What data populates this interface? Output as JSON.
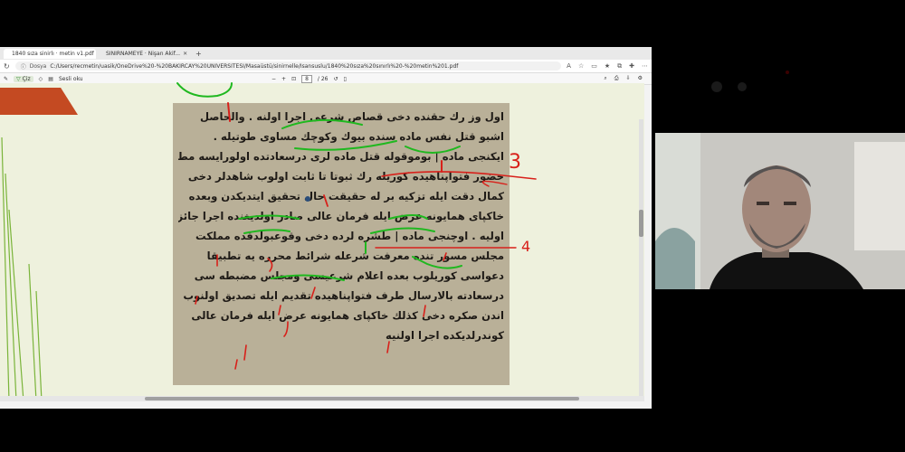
{
  "browser": {
    "tabs": [
      {
        "label": "1840 sıza sinirlı · metin v1.pdf",
        "active": true,
        "icon": "pdf-icon"
      },
      {
        "label": "SINIRNAMEYE · Nişan Akif...",
        "active": false,
        "icon": "page-icon"
      }
    ],
    "new_tab_label": "+",
    "address": {
      "site_label": "Dosya",
      "url": "C:/Users/recmetin/uasik/OneDrive%20-%20BAKIRCAY%20UNIVERSITESI/Masaüstü/sinirnelle/Isansuslu/1840%20sıza%20sınırlı%20-%20metin%201.pdf"
    },
    "pdf_toolbar": {
      "draw_label": "Çiz",
      "page_current": "8",
      "page_total": "/ 26",
      "zoom_minus": "−",
      "zoom_plus": "+",
      "read_aloud": "Sesli oku"
    }
  },
  "manuscript": {
    "lines": [
      "اول وز رك حقنده دخی قصاص شرعی اجرا اولنه . والحاصل",
      "اشبو قتل نفس ماده سنده بیوك وكوچك مساوی طوتیله .",
      "ایكنجی ماده | بوموقوله قتل ماده لری درسعادتده اولورایسه مطلقا",
      "حضور فتواپناهیده كوریله رك ثبوتا تا ثابت اولوب شاهدلر دخی",
      "كمال دقت ایله تزكیه بر له حقیقت حال تحقیق ایتدیكدن وبعده",
      "خاكپای همایونه عرض ایله فرمان عالی صادر اولدیغنده اجرا جائز",
      "اولیه . اوچنجی ماده | طشره لرده دخی وقوعبولدقده مملكت",
      "مجلس مسور تنده معرفت شرعله شرائط محرره یه تطبیقا",
      "دعواسی كوریلوب بعده اعلام شرعیسی ومجلس مضبطه سی",
      "درسعادته بالارسال طرف فتواپناهیده تقدیم ایله تصدیق اولنوب",
      "اندن صكره دخی كذلك خاكپای همایونه عرض ایله فرمان عالی",
      "كوندرلدیكده اجرا اولنیه"
    ],
    "annotations": {
      "mark_3": "3",
      "mark_4": "4"
    }
  },
  "colors": {
    "slide_bg": "#eef1dd",
    "accent_red": "#c44a22",
    "pen_red": "#d8201a",
    "pen_green": "#1fb81f",
    "scan_bg": "#b9b098"
  }
}
